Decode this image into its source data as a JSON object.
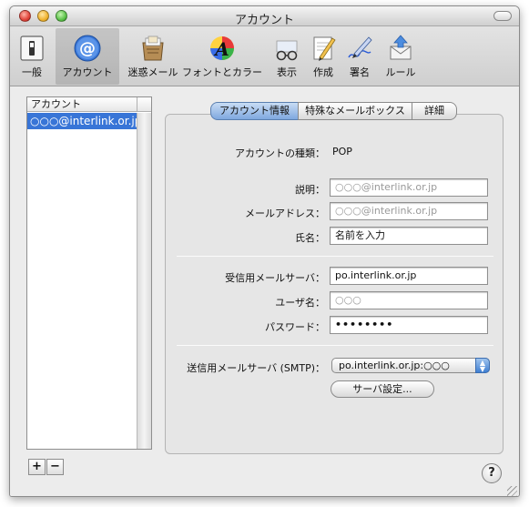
{
  "window": {
    "title": "アカウント"
  },
  "toolbar": {
    "items": [
      {
        "label": "一般",
        "icon": "general-switch-icon"
      },
      {
        "label": "アカウント",
        "icon": "at-sign-icon",
        "selected": true
      },
      {
        "label": "迷惑メール",
        "icon": "junk-mail-icon"
      },
      {
        "label": "フォントとカラー",
        "icon": "fonts-colors-icon"
      },
      {
        "label": "表示",
        "icon": "glasses-icon"
      },
      {
        "label": "作成",
        "icon": "compose-pencil-icon"
      },
      {
        "label": "署名",
        "icon": "signature-pen-icon"
      },
      {
        "label": "ルール",
        "icon": "rules-envelope-icon"
      }
    ]
  },
  "accounts_list": {
    "header": "アカウント",
    "items": [
      "○○○@interlink.or.jp"
    ],
    "selected_color": "#3875d7"
  },
  "tabs": [
    {
      "label": "アカウント情報",
      "active": true
    },
    {
      "label": "特殊なメールボックス",
      "active": false
    },
    {
      "label": "詳細",
      "active": false
    }
  ],
  "account_info": {
    "type_label": "アカウントの種類：",
    "type_value": "POP",
    "description_label": "説明：",
    "description_value": "○○○@interlink.or.jp",
    "email_label": "メールアドレス：",
    "email_value": "○○○@interlink.or.jp",
    "name_label": "氏名：",
    "name_value": "名前を入力",
    "incoming_server_label": "受信用メールサーバ：",
    "incoming_server_value": "po.interlink.or.jp",
    "username_label": "ユーザ名：",
    "username_value": "○○○",
    "password_label": "パスワード：",
    "password_value": "••••••••",
    "smtp_label": "送信用メールサーバ (SMTP)：",
    "smtp_value": "po.interlink.or.jp:○○○",
    "server_settings_button": "サーバ設定..."
  },
  "footer": {
    "add_label": "+",
    "remove_label": "−",
    "help_label": "?"
  }
}
